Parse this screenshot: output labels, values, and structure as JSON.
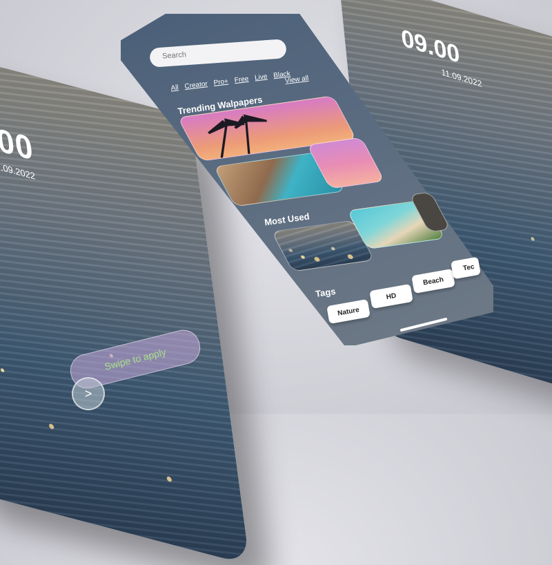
{
  "left_screen": {
    "time": "00",
    "date": ".09.2022",
    "swipe_label": "Swipe to apply",
    "swipe_icon": ">"
  },
  "right_screen": {
    "time": "09.00",
    "date": "11.09.2022"
  },
  "app": {
    "search_placeholder": "Search",
    "filters": [
      "All",
      "Creator",
      "Pro+",
      "Free",
      "Live",
      "Black"
    ],
    "view_all": "View all",
    "trending_title": "Trending Walpapers",
    "most_used_title": "Most Used",
    "tags_title": "Tags",
    "tags": [
      "Nature",
      "HD",
      "Beach",
      "Tec"
    ]
  },
  "colors": {
    "phone_blue": "#4a5f78",
    "swipe_text": "#a8e08a",
    "search_placeholder": "#d8a8b0"
  }
}
